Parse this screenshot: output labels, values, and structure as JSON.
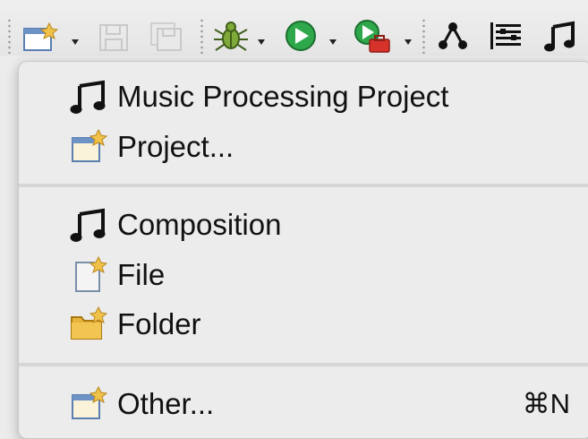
{
  "toolbar": {
    "items": [
      {
        "name": "new-wizard-icon",
        "has_dropdown": true
      },
      {
        "name": "save-icon",
        "has_dropdown": false,
        "disabled": true
      },
      {
        "name": "save-all-icon",
        "has_dropdown": false,
        "disabled": true
      },
      {
        "name": "debug-bug-icon",
        "has_dropdown": true
      },
      {
        "name": "run-play-icon",
        "has_dropdown": true
      },
      {
        "name": "run-external-tool-icon",
        "has_dropdown": true
      },
      {
        "name": "tree-graph-icon",
        "has_dropdown": false
      },
      {
        "name": "score-lines-icon",
        "has_dropdown": false
      },
      {
        "name": "music-note-icon",
        "has_dropdown": false
      }
    ]
  },
  "menu": {
    "items": [
      {
        "label": "Music Processing Project",
        "icon": "music-note-icon"
      },
      {
        "label": "Project...",
        "icon": "new-project-icon"
      },
      {
        "label": "Composition",
        "icon": "music-note-icon"
      },
      {
        "label": "File",
        "icon": "new-file-icon"
      },
      {
        "label": "Folder",
        "icon": "new-folder-icon"
      },
      {
        "label": "Other...",
        "icon": "new-other-icon",
        "shortcut": "⌘N"
      }
    ]
  },
  "colors": {
    "menu_bg": "#ececec",
    "accent_gold": "#e8b33a",
    "run_green": "#2ea84a",
    "tool_red": "#d8332b"
  }
}
